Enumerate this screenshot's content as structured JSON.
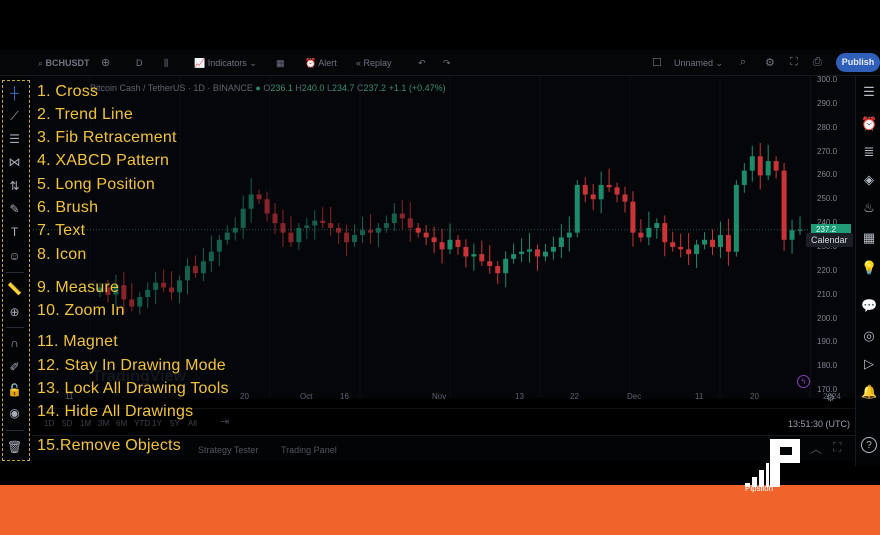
{
  "toolbar": {
    "symbol": "BCHUSDT",
    "interval": "D",
    "indicators": "Indicators",
    "alert": "Alert",
    "replay": "Replay",
    "layout_name": "Unnamed",
    "publish": "Publish"
  },
  "legend": {
    "title": "Bitcoin Cash / TetherUS · 1D · BINANCE",
    "o_label": "O",
    "o": "236.1",
    "h_label": "H",
    "h": "240.0",
    "l_label": "L",
    "l": "234.7",
    "c_label": "C",
    "c": "237.2",
    "change": "+1.1 (+0.47%)"
  },
  "price_axis": {
    "ticks": [
      "300.0",
      "290.0",
      "280.0",
      "270.0",
      "260.0",
      "250.0",
      "240.0",
      "230.0",
      "220.0",
      "210.0",
      "200.0",
      "190.0",
      "180.0",
      "170.0"
    ],
    "last_price": "237.2"
  },
  "tooltip": "Calendar",
  "time_axis": {
    "labels": [
      "11",
      "20",
      "Oct",
      "16",
      "Nov",
      "13",
      "22",
      "Dec",
      "11",
      "20",
      "2024"
    ]
  },
  "range_buttons": [
    "1D",
    "5D",
    "1M",
    "3M",
    "6M",
    "YTD",
    "1Y",
    "5Y",
    "All"
  ],
  "clock": "13:51:30 (UTC)",
  "bottom_tabs": [
    "Strategy Tester",
    "Trading Panel"
  ],
  "watermark": "TradingView",
  "colors": {
    "up": "#1f9c76",
    "down": "#e0393e",
    "annotation": "#f2c33a",
    "brand_band": "#f0632a",
    "publish": "#2f5fb8"
  },
  "candles_close": [
    213,
    210,
    214,
    208,
    205,
    209,
    212,
    215,
    213,
    211,
    216,
    222,
    219,
    224,
    228,
    233,
    236,
    238,
    246,
    252,
    250,
    244,
    240,
    236,
    232,
    238,
    239,
    241,
    240,
    238,
    236,
    232,
    235,
    237,
    236,
    238,
    240,
    244,
    242,
    238,
    236,
    234,
    232,
    229,
    233,
    230,
    226,
    227,
    224,
    222,
    219,
    225,
    227,
    228,
    229,
    226,
    228,
    230,
    234,
    236,
    256,
    252,
    250,
    256,
    255,
    252,
    249,
    236,
    234,
    238,
    240,
    232,
    230,
    229,
    227,
    231,
    233,
    230,
    235,
    228,
    256,
    262,
    268,
    260,
    266,
    262,
    233,
    237,
    237.2
  ],
  "tools": [
    {
      "icon": "cross-icon",
      "label": "1. Cross"
    },
    {
      "icon": "trend-line-icon",
      "label": "2. Trend Line"
    },
    {
      "icon": "fib-retracement-icon",
      "label": "3. Fib Retracement"
    },
    {
      "icon": "xabcd-pattern-icon",
      "label": "4. XABCD Pattern"
    },
    {
      "icon": "long-position-icon",
      "label": "5. Long Position"
    },
    {
      "icon": "brush-icon",
      "label": "6. Brush"
    },
    {
      "icon": "text-icon",
      "label": "7. Text"
    },
    {
      "icon": "emoji-icon",
      "label": "8. Icon"
    },
    {
      "icon": "ruler-icon",
      "label": "9. Measure"
    },
    {
      "icon": "zoom-in-icon",
      "label": "10. Zoom In"
    },
    {
      "icon": "magnet-icon",
      "label": "11. Magnet"
    },
    {
      "icon": "stay-drawing-icon",
      "label": "12. Stay In Drawing Mode"
    },
    {
      "icon": "lock-icon",
      "label": "13. Lock All Drawing Tools"
    },
    {
      "icon": "eye-icon",
      "label": "14. Hide All Drawings"
    },
    {
      "icon": "trash-icon",
      "label": "15.Remove Objects"
    }
  ],
  "right_icons": [
    "watchlist-icon",
    "alarm-clock-icon",
    "data-window-icon",
    "layers-icon",
    "hotlist-icon",
    "calendar-icon",
    "ideas-icon",
    "chat-icon",
    "streams-icon",
    "replay-icon",
    "bell-icon",
    "help-icon"
  ],
  "brand": "Pipsilon"
}
